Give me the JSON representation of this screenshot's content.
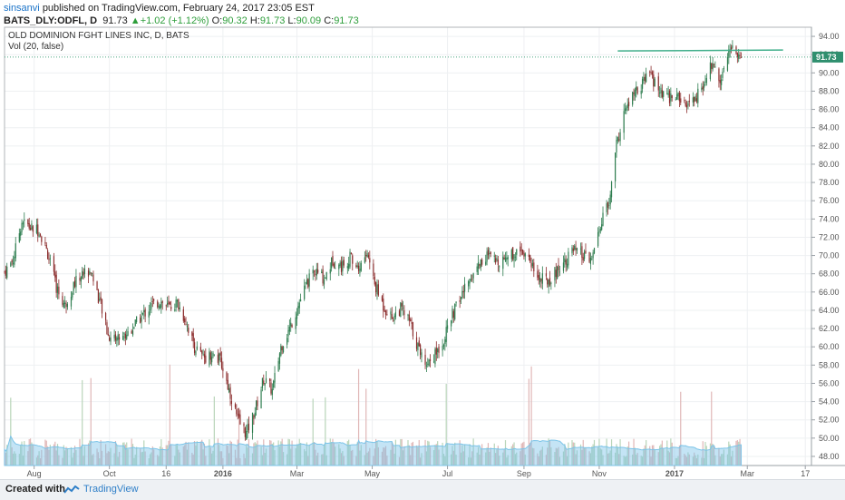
{
  "header": {
    "user": "sinsanvi",
    "published": "published on TradingView.com, February 24, 2017 23:05 EST",
    "symbol": "BATS_DLY:ODFL, D",
    "last": "91.73",
    "change": "+1.02 (+1.12%)",
    "o_label": "O:",
    "o_value": "90.32",
    "h_label": "H:",
    "h_value": "91.73",
    "l_label": "L:",
    "l_value": "90.09",
    "c_label": "C:",
    "c_value": "91.73"
  },
  "legend": {
    "title": "OLD DOMINION FGHT LINES INC, D, BATS",
    "volume": "Vol (20, false)"
  },
  "footer": {
    "created": "Created with",
    "brand": "TradingView"
  },
  "colors": {
    "up": "#2e7d4f",
    "down": "#8b2c2c",
    "volume_up": "#b9d5b9",
    "volume_down": "#e0b7b7",
    "volume_ma": "#7cc4e8",
    "trendline": "#3fae8a",
    "price_line": "#4fa784",
    "price_tag": "#2f8f6e"
  },
  "chart_data": {
    "type": "candlestick",
    "title": "OLD DOMINION FGHT LINES INC, D, BATS",
    "ylim": [
      47,
      95
    ],
    "y_ticks": [
      48,
      50,
      52,
      54,
      56,
      58,
      60,
      62,
      64,
      66,
      68,
      70,
      72,
      74,
      76,
      78,
      80,
      82,
      84,
      86,
      88,
      90,
      92,
      94
    ],
    "x_ticks": [
      {
        "label": "Aug",
        "x": "2015-08-01"
      },
      {
        "label": "Oct",
        "x": "2015-10-01"
      },
      {
        "label": "16",
        "x": "2015-11-16"
      },
      {
        "label": "2016",
        "x": "2016-01-01"
      },
      {
        "label": "Mar",
        "x": "2016-03-01"
      },
      {
        "label": "May",
        "x": "2016-05-01"
      },
      {
        "label": "Jul",
        "x": "2016-07-01"
      },
      {
        "label": "Sep",
        "x": "2016-09-01"
      },
      {
        "label": "Nov",
        "x": "2016-11-01"
      },
      {
        "label": "2017",
        "x": "2017-01-01"
      },
      {
        "label": "Mar",
        "x": "2017-03-01"
      },
      {
        "label": "17",
        "x": "2017-04-17"
      }
    ],
    "x_range": [
      "2015-07-08",
      "2017-04-22"
    ],
    "last_price": 91.73,
    "close_path": [
      {
        "x": "2015-07-08",
        "y": 68.2
      },
      {
        "x": "2015-07-15",
        "y": 69.5
      },
      {
        "x": "2015-07-22",
        "y": 73.8
      },
      {
        "x": "2015-07-29",
        "y": 73.0
      },
      {
        "x": "2015-08-05",
        "y": 72.8
      },
      {
        "x": "2015-08-12",
        "y": 70.2
      },
      {
        "x": "2015-08-19",
        "y": 66.5
      },
      {
        "x": "2015-08-26",
        "y": 64.5
      },
      {
        "x": "2015-09-02",
        "y": 66.8
      },
      {
        "x": "2015-09-09",
        "y": 68.0
      },
      {
        "x": "2015-09-16",
        "y": 68.4
      },
      {
        "x": "2015-09-23",
        "y": 65.0
      },
      {
        "x": "2015-09-30",
        "y": 61.2
      },
      {
        "x": "2015-10-07",
        "y": 61.0
      },
      {
        "x": "2015-10-14",
        "y": 61.3
      },
      {
        "x": "2015-10-21",
        "y": 62.3
      },
      {
        "x": "2015-10-28",
        "y": 63.5
      },
      {
        "x": "2015-11-04",
        "y": 64.5
      },
      {
        "x": "2015-11-11",
        "y": 65.0
      },
      {
        "x": "2015-11-18",
        "y": 64.3
      },
      {
        "x": "2015-11-25",
        "y": 64.8
      },
      {
        "x": "2015-12-02",
        "y": 62.8
      },
      {
        "x": "2015-12-09",
        "y": 60.0
      },
      {
        "x": "2015-12-16",
        "y": 58.8
      },
      {
        "x": "2015-12-23",
        "y": 59.2
      },
      {
        "x": "2015-12-30",
        "y": 58.5
      },
      {
        "x": "2016-01-06",
        "y": 55.3
      },
      {
        "x": "2016-01-13",
        "y": 52.0
      },
      {
        "x": "2016-01-20",
        "y": 50.5
      },
      {
        "x": "2016-01-27",
        "y": 53.0
      },
      {
        "x": "2016-02-03",
        "y": 56.5
      },
      {
        "x": "2016-02-10",
        "y": 55.2
      },
      {
        "x": "2016-02-17",
        "y": 60.0
      },
      {
        "x": "2016-02-24",
        "y": 62.0
      },
      {
        "x": "2016-03-02",
        "y": 64.5
      },
      {
        "x": "2016-03-09",
        "y": 67.0
      },
      {
        "x": "2016-03-16",
        "y": 68.2
      },
      {
        "x": "2016-03-23",
        "y": 67.5
      },
      {
        "x": "2016-03-30",
        "y": 69.5
      },
      {
        "x": "2016-04-06",
        "y": 68.8
      },
      {
        "x": "2016-04-13",
        "y": 69.8
      },
      {
        "x": "2016-04-20",
        "y": 68.5
      },
      {
        "x": "2016-04-27",
        "y": 70.3
      },
      {
        "x": "2016-05-03",
        "y": 66.8
      },
      {
        "x": "2016-05-10",
        "y": 64.5
      },
      {
        "x": "2016-05-17",
        "y": 63.2
      },
      {
        "x": "2016-05-24",
        "y": 64.2
      },
      {
        "x": "2016-05-31",
        "y": 62.8
      },
      {
        "x": "2016-06-07",
        "y": 60.0
      },
      {
        "x": "2016-06-14",
        "y": 58.2
      },
      {
        "x": "2016-06-21",
        "y": 59.2
      },
      {
        "x": "2016-06-28",
        "y": 60.8
      },
      {
        "x": "2016-07-05",
        "y": 63.5
      },
      {
        "x": "2016-07-12",
        "y": 65.5
      },
      {
        "x": "2016-07-19",
        "y": 67.5
      },
      {
        "x": "2016-07-26",
        "y": 69.0
      },
      {
        "x": "2016-08-02",
        "y": 70.0
      },
      {
        "x": "2016-08-09",
        "y": 69.3
      },
      {
        "x": "2016-08-16",
        "y": 69.8
      },
      {
        "x": "2016-08-23",
        "y": 70.2
      },
      {
        "x": "2016-08-30",
        "y": 70.8
      },
      {
        "x": "2016-09-06",
        "y": 69.5
      },
      {
        "x": "2016-09-13",
        "y": 67.5
      },
      {
        "x": "2016-09-20",
        "y": 67.2
      },
      {
        "x": "2016-09-27",
        "y": 68.2
      },
      {
        "x": "2016-10-04",
        "y": 69.5
      },
      {
        "x": "2016-10-11",
        "y": 70.5
      },
      {
        "x": "2016-10-18",
        "y": 70.0
      },
      {
        "x": "2016-10-25",
        "y": 69.3
      },
      {
        "x": "2016-11-01",
        "y": 72.5
      },
      {
        "x": "2016-11-04",
        "y": 74.5
      },
      {
        "x": "2016-11-09",
        "y": 75.5
      },
      {
        "x": "2016-11-14",
        "y": 81.5
      },
      {
        "x": "2016-11-21",
        "y": 85.5
      },
      {
        "x": "2016-11-28",
        "y": 87.5
      },
      {
        "x": "2016-12-05",
        "y": 88.5
      },
      {
        "x": "2016-12-12",
        "y": 90.0
      },
      {
        "x": "2016-12-19",
        "y": 88.0
      },
      {
        "x": "2016-12-26",
        "y": 87.2
      },
      {
        "x": "2017-01-03",
        "y": 87.5
      },
      {
        "x": "2017-01-10",
        "y": 86.2
      },
      {
        "x": "2017-01-17",
        "y": 87.0
      },
      {
        "x": "2017-01-24",
        "y": 88.5
      },
      {
        "x": "2017-01-31",
        "y": 91.0
      },
      {
        "x": "2017-02-07",
        "y": 89.5
      },
      {
        "x": "2017-02-14",
        "y": 92.5
      },
      {
        "x": "2017-02-17",
        "y": 92.8
      },
      {
        "x": "2017-02-21",
        "y": 91.8
      },
      {
        "x": "2017-02-24",
        "y": 91.73
      }
    ],
    "annotations": [
      {
        "type": "trendline",
        "from": {
          "x": "2016-11-16",
          "y": 92.4
        },
        "to": {
          "x": "2017-03-30",
          "y": 92.5
        }
      }
    ]
  }
}
